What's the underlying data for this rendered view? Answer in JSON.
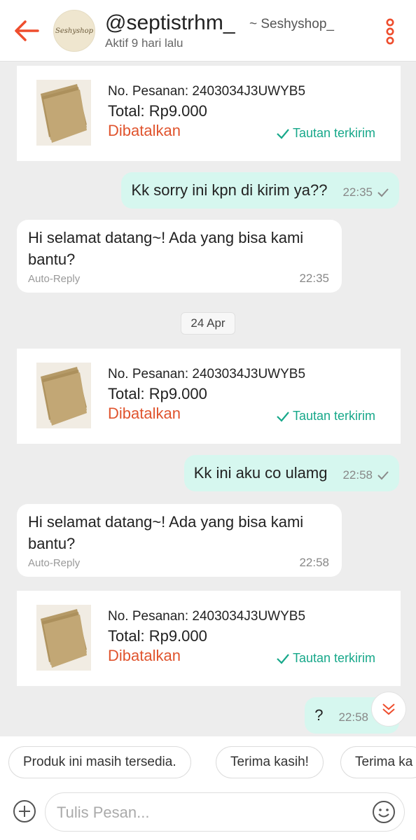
{
  "header": {
    "username": "@septistrhm_",
    "shop_name": "~ Seshyshop_",
    "status": "Aktif 9 hari lalu",
    "avatar_text": "Seshyshop",
    "back_icon": "arrow-left-icon",
    "more_icon": "more-vertical-icon",
    "accent_color": "#ee4d2d"
  },
  "orders": [
    {
      "number": "No. Pesanan: 2403034J3UWYB5",
      "total": "Total: Rp9.000",
      "status": "Dibatalkan",
      "link": "Tautan terkirim"
    },
    {
      "number": "No. Pesanan: 2403034J3UWYB5",
      "total": "Total: Rp9.000",
      "status": "Dibatalkan",
      "link": "Tautan terkirim"
    },
    {
      "number": "No. Pesanan: 2403034J3UWYB5",
      "total": "Total: Rp9.000",
      "status": "Dibatalkan",
      "link": "Tautan terkirim"
    }
  ],
  "messages": {
    "out1": {
      "text": "Kk sorry ini kpn di kirim ya??",
      "time": "22:35"
    },
    "in1": {
      "text": "Hi selamat datang~! Ada yang bisa kami bantu?",
      "label": "Auto-Reply",
      "time": "22:35"
    },
    "date_divider": "24 Apr",
    "out2": {
      "text": "Kk ini aku co ulamg",
      "time": "22:58"
    },
    "in2": {
      "text": "Hi selamat datang~! Ada yang bisa kami bantu?",
      "label": "Auto-Reply",
      "time": "22:58"
    },
    "out3": {
      "text": "?",
      "time": "22:58"
    }
  },
  "quick_replies": [
    "Produk ini masih tersedia.",
    "Terima kasih!",
    "Terima ka"
  ],
  "input": {
    "placeholder": "Tulis Pesan..."
  },
  "colors": {
    "outgoing_bubble": "#d6f7ef",
    "link_green": "#17a88a",
    "cancel_red": "#e0542e"
  }
}
